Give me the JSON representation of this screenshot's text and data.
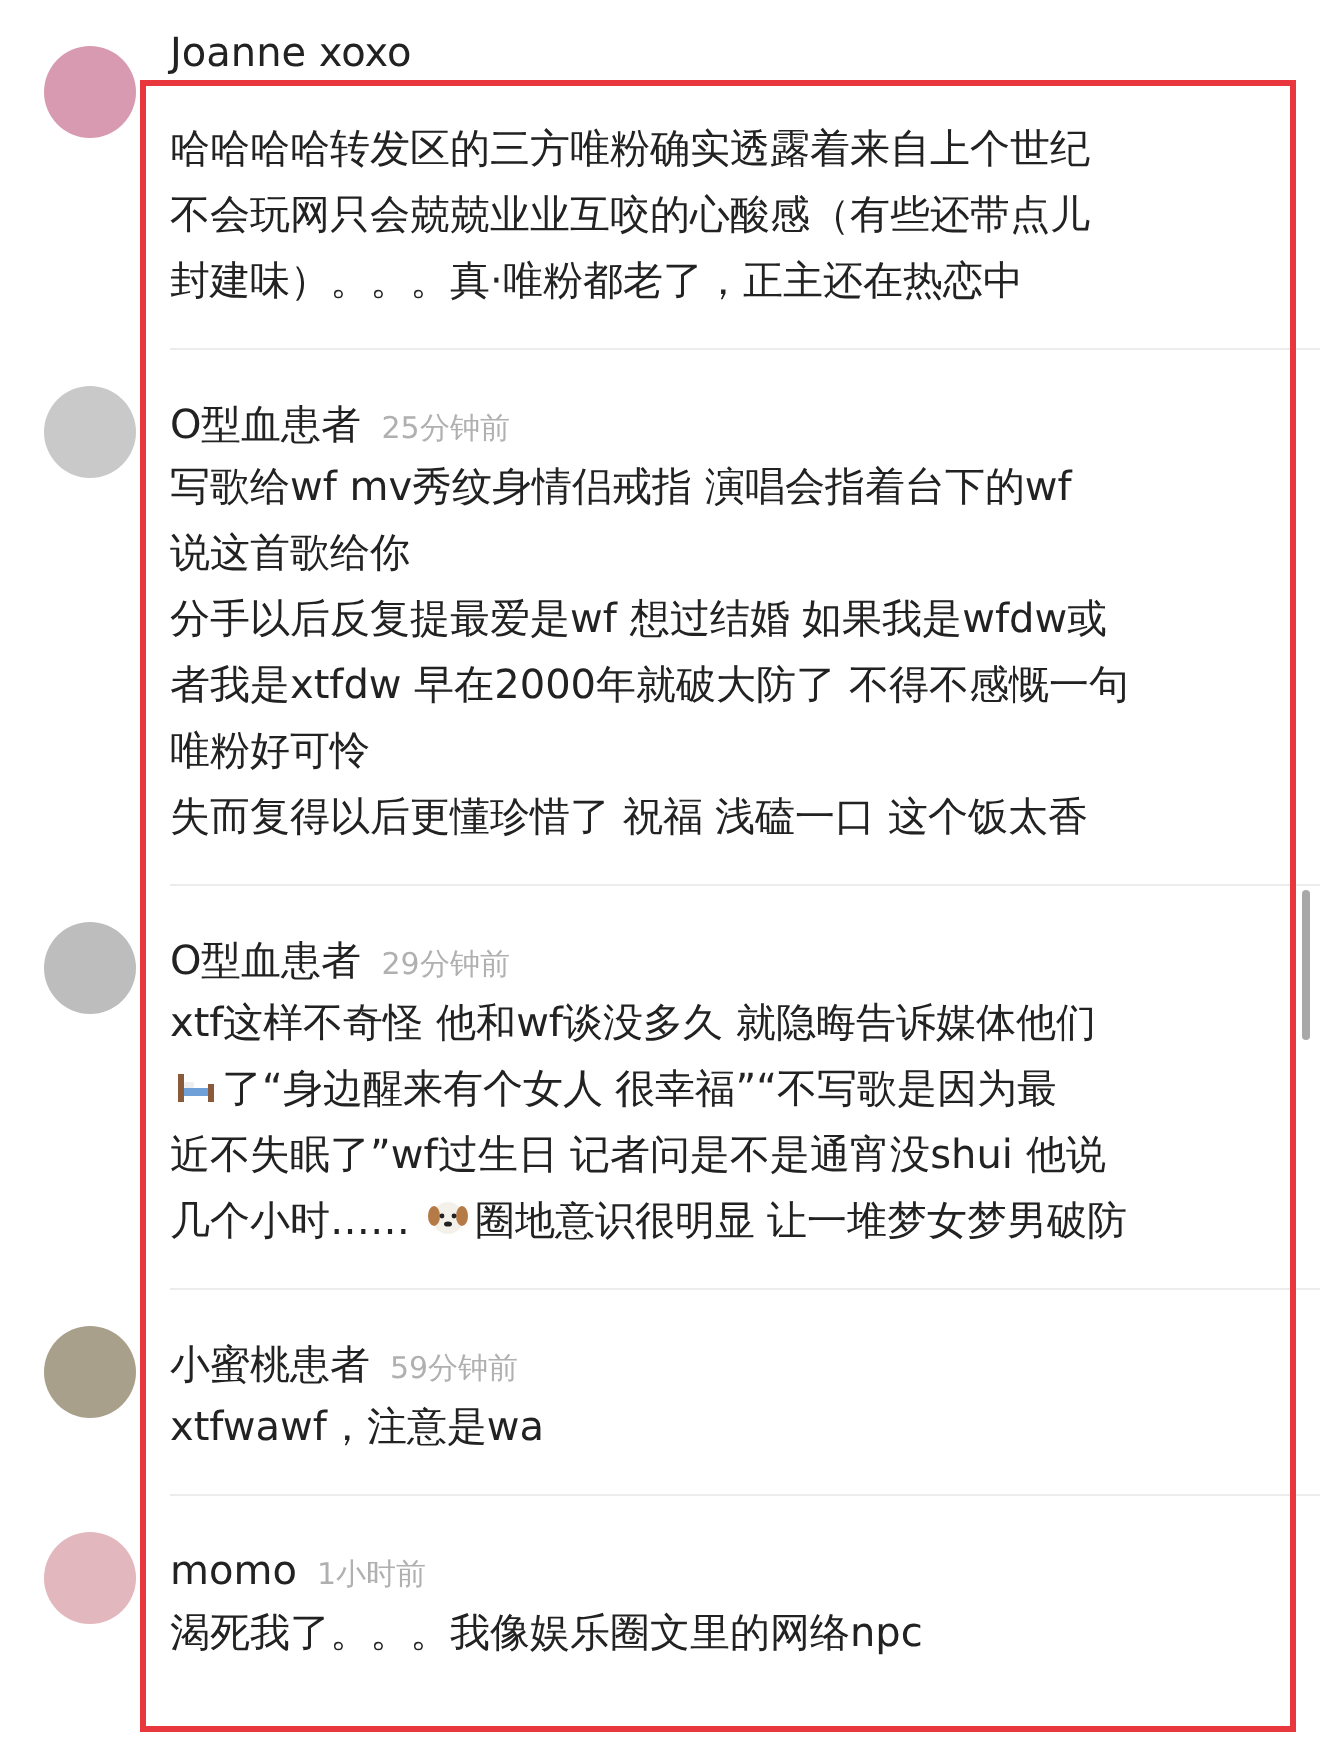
{
  "comments": [
    {
      "user": "Joanne xoxo",
      "lines": [
        {
          "text": "哈哈哈哈转发区的三方唯粉确实透露着来自上个世纪"
        },
        {
          "text": "不会玩网只会兢兢业业互咬的心酸感（有些还带点儿"
        },
        {
          "text": "封建味）。。。真·唯粉都老了，正主还在热恋中"
        }
      ]
    },
    {
      "user": "O型血患者",
      "time": "25分钟前",
      "lines": [
        {
          "text": "写歌给wf  mv秀纹身情侣戒指  演唱会指着台下的wf"
        },
        {
          "text": "说这首歌给你"
        },
        {
          "text": "分手以后反复提最爱是wf 想过结婚 如果我是wfdw或"
        },
        {
          "text": "者我是xtfdw 早在2000年就破大防了 不得不感慨一句"
        },
        {
          "text": "唯粉好可怜"
        },
        {
          "text": "失而复得以后更懂珍惜了 祝福 浅磕一口 这个饭太香"
        }
      ]
    },
    {
      "user": "O型血患者",
      "time": "29分钟前",
      "lines": [
        {
          "text": "xtf这样不奇怪 他和wf谈没多久 就隐晦告诉媒体他们"
        },
        {
          "kind": "icon",
          "after": "了“身边醒来有个女人 很幸福”“不写歌是因为最"
        },
        {
          "text": "近不失眠了”wf过生日 记者问是不是通宵没shui 他说"
        },
        {
          "kind": "icon",
          "before": "几个小时…… ",
          "after": "圈地意识很明显 让一堆梦女梦男破防"
        }
      ]
    },
    {
      "user": "小蜜桃患者",
      "time": "59分钟前",
      "lines": [
        {
          "text": "xtfwawf，注意是wa"
        }
      ]
    },
    {
      "user": "momo",
      "time": "1小时前",
      "lines": [
        {
          "text": "渴死我了。。。我像娱乐圈文里的网络npc"
        }
      ]
    }
  ]
}
